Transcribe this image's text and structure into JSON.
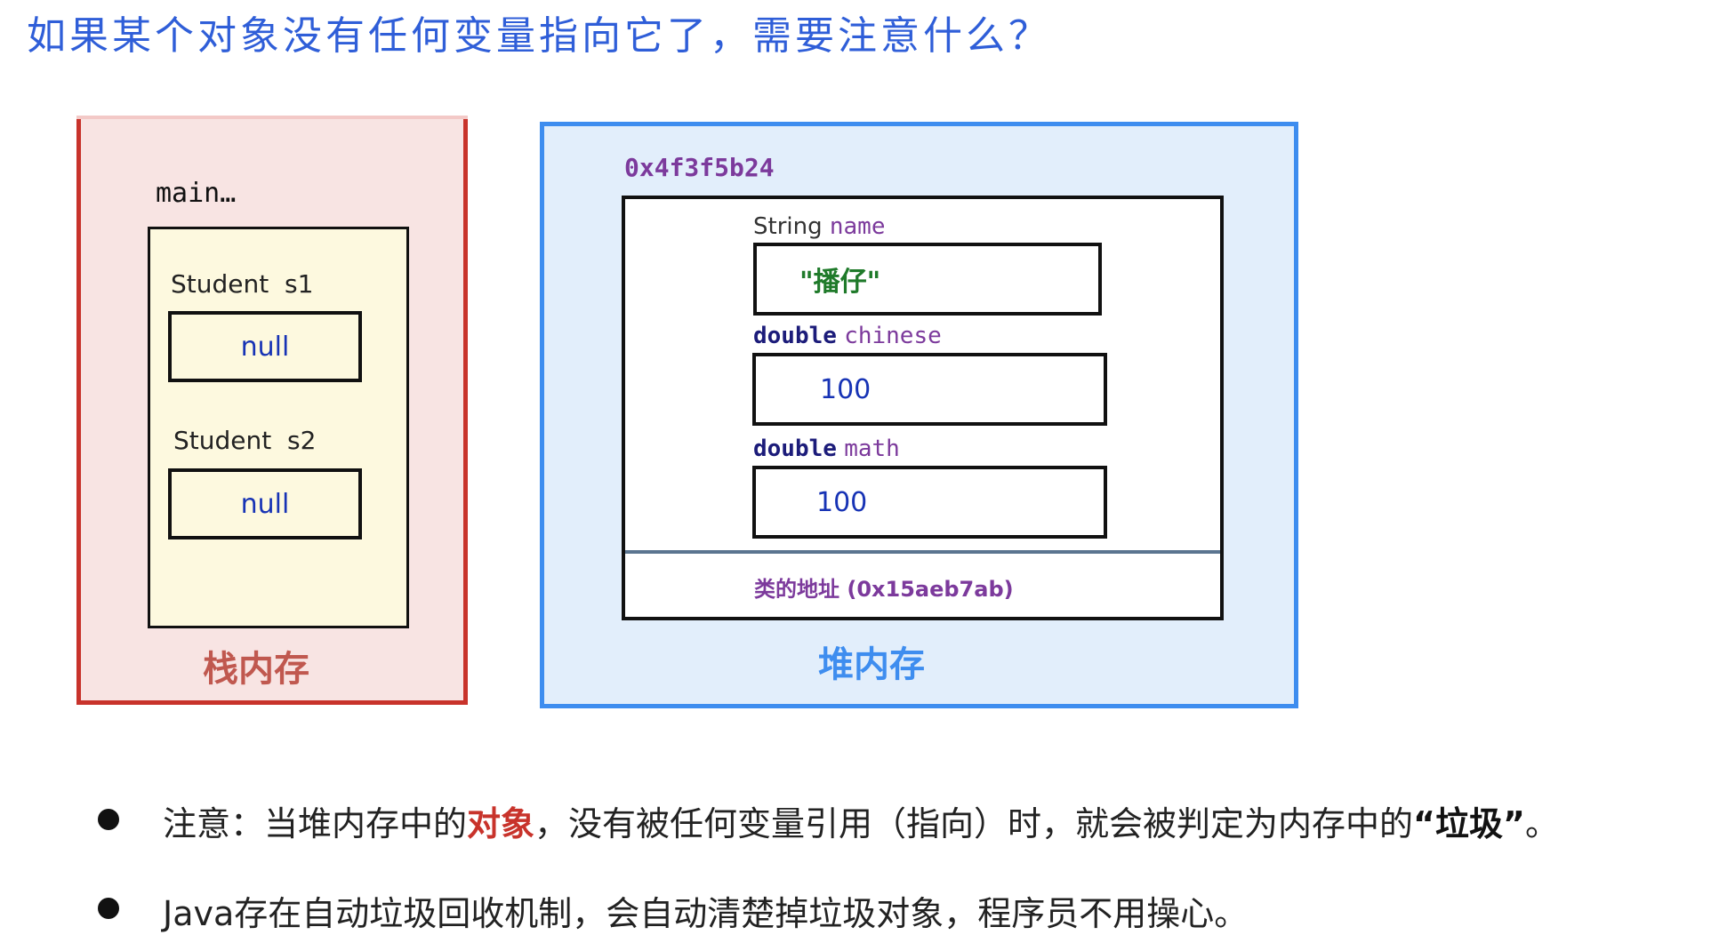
{
  "title": "如果某个对象没有任何变量指向它了，需要注意什么？",
  "stack": {
    "method_label": "main…",
    "vars": [
      {
        "label": "Student  s1",
        "value": "null"
      },
      {
        "label": "Student  s2",
        "value": "null"
      }
    ],
    "name": "栈内存"
  },
  "heap": {
    "object_address": "0x4f3f5b24",
    "fields": [
      {
        "type": "String",
        "name": "name",
        "value": "\"播仔\""
      },
      {
        "type": "double",
        "name": "chinese",
        "value": "100"
      },
      {
        "type": "double",
        "name": "math",
        "value": "100"
      }
    ],
    "class_address": "类的地址 (0x15aeb7ab)",
    "name": "堆内存"
  },
  "bullets": {
    "b1_part1": "注意：当堆内存中的",
    "b1_highlight": "对象",
    "b1_part2": "，没有被任何变量引用（指向）时，就会被判定为内存中的",
    "b1_bold": "“垃圾”",
    "b1_end": "。",
    "b2": "Java存在自动垃圾回收机制，会自动清楚掉垃圾对象，程序员不用操心。"
  },
  "colors": {
    "stack_border": "#c8332b",
    "stack_fill": "#f8e4e3",
    "heap_border": "#3e8def",
    "heap_fill": "#e2eefb",
    "title": "#2f5ed8"
  }
}
